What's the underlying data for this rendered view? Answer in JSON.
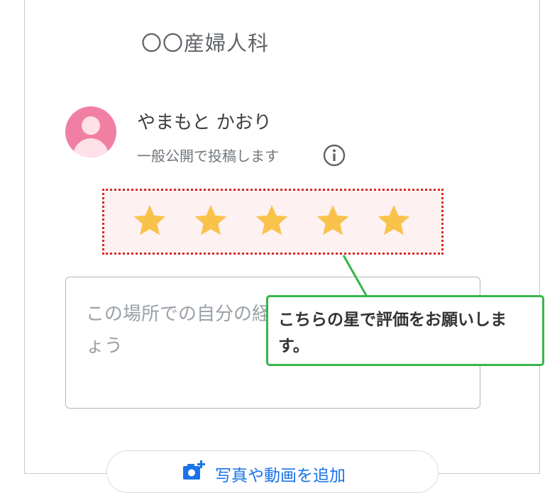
{
  "header": {
    "title": "〇〇産婦人科"
  },
  "user": {
    "name": "やまもと かおり",
    "visibility_note": "一般公開で投稿します",
    "avatar_color": "#f07fa3"
  },
  "rating": {
    "stars_shown": 5,
    "star_color": "#f9c34b",
    "highlight_color": "#d52b2b"
  },
  "review": {
    "placeholder": "この場所での自分の経験や感想を共有しましょう"
  },
  "callout": {
    "text": "こちらの星で評価をお願いします。",
    "border_color": "#36b54a"
  },
  "actions": {
    "add_media_label": "写真や動画を追加"
  }
}
